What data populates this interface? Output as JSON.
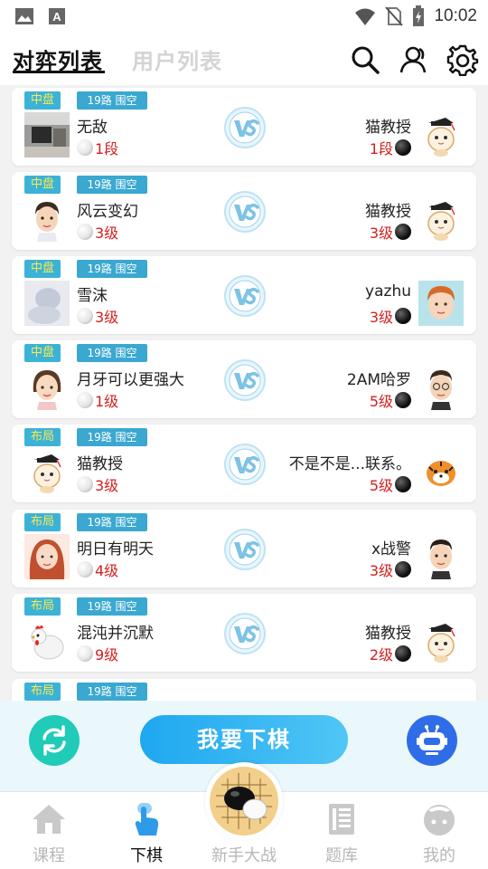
{
  "status_bar": {
    "time": "10:02",
    "left_icons": [
      "image-icon",
      "app-a-icon"
    ],
    "right_icons": [
      "wifi-icon",
      "no-sim-icon",
      "battery-charging-icon"
    ]
  },
  "header": {
    "tabs": [
      {
        "label": "对弈列表",
        "active": true
      },
      {
        "label": "用户列表",
        "active": false
      }
    ],
    "icons": [
      "search-icon",
      "friends-icon",
      "settings-icon"
    ]
  },
  "games": [
    {
      "stage": "中盘",
      "board": "19路 围空",
      "left_name": "无敌",
      "left_rank": "1段",
      "left_avatar": "room-photo",
      "right_name": "猫教授",
      "right_rank": "1段",
      "right_avatar": "cat-professor"
    },
    {
      "stage": "中盘",
      "board": "19路 围空",
      "left_name": "风云变幻",
      "left_rank": "3级",
      "left_avatar": "man-cartoon",
      "right_name": "猫教授",
      "right_rank": "3级",
      "right_avatar": "cat-professor"
    },
    {
      "stage": "中盘",
      "board": "19路 围空",
      "left_name": "雪沫",
      "left_rank": "3级",
      "left_avatar": "blur-photo",
      "right_name": "yazhu",
      "right_rank": "3级",
      "right_avatar": "redhead-cartoon"
    },
    {
      "stage": "中盘",
      "board": "19路 围空",
      "left_name": "月牙可以更强大",
      "left_rank": "1级",
      "left_avatar": "woman-cartoon",
      "right_name": "2AM哈罗",
      "right_rank": "5级",
      "right_avatar": "glasses-man-cartoon"
    },
    {
      "stage": "布局",
      "board": "19路 围空",
      "left_name": "猫教授",
      "left_rank": "3级",
      "left_avatar": "cat-professor",
      "right_name": "不是不是...联系。",
      "right_rank": "5级",
      "right_avatar": "tiger-cartoon"
    },
    {
      "stage": "布局",
      "board": "19路 围空",
      "left_name": "明日有明天",
      "left_rank": "4级",
      "left_avatar": "redhair-woman-cartoon",
      "right_name": "x战警",
      "right_rank": "3级",
      "right_avatar": "man-cartoon-2"
    },
    {
      "stage": "布局",
      "board": "19路 围空",
      "left_name": "混沌并沉默",
      "left_rank": "9级",
      "left_avatar": "chicken-cartoon",
      "right_name": "猫教授",
      "right_rank": "2级",
      "right_avatar": "cat-professor"
    },
    {
      "stage": "布局",
      "board": "19路 围空",
      "left_name": "",
      "left_rank": "",
      "left_avatar": "",
      "right_name": "",
      "right_rank": "",
      "right_avatar": ""
    }
  ],
  "actions": {
    "play_label": "我要下棋",
    "refresh_icon": "refresh-icon",
    "robot_icon": "robot-icon"
  },
  "nav": [
    {
      "label": "课程",
      "icon": "home-icon",
      "active": false
    },
    {
      "label": "下棋",
      "icon": "tap-icon",
      "active": true
    },
    {
      "label": "新手大战",
      "icon": "go-board-icon",
      "active": false
    },
    {
      "label": "题库",
      "icon": "question-bank-icon",
      "active": false
    },
    {
      "label": "我的",
      "icon": "profile-icon",
      "active": false
    }
  ],
  "colors": {
    "accent": "#1ea7f0",
    "rank_red": "#d42020",
    "badge_blue": "#3aa8d0",
    "stage_yellow": "#ffe94a",
    "refresh_teal": "#20cbb8",
    "robot_blue": "#2f6de8"
  }
}
